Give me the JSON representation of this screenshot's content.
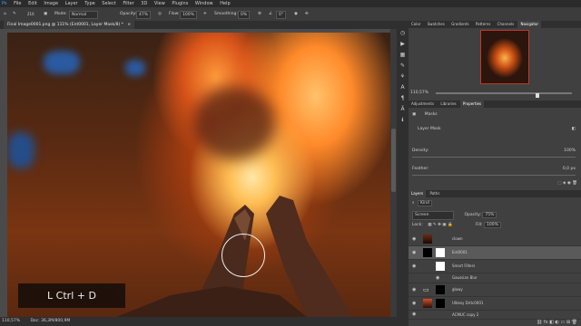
{
  "menu": [
    "Ps",
    "File",
    "Edit",
    "Image",
    "Layer",
    "Type",
    "Select",
    "Filter",
    "3D",
    "View",
    "Plugins",
    "Window",
    "Help"
  ],
  "options": {
    "brush_size": "216",
    "mode_label": "Mode:",
    "mode_value": "Normal",
    "opacity_label": "Opacity:",
    "opacity_value": "47%",
    "flow_label": "Flow:",
    "flow_value": "100%",
    "smoothing_label": "Smoothing:",
    "smoothing_value": "0%",
    "angle_value": "0°"
  },
  "document": {
    "tab_title": "Final Image0001.png @ 111% (Ent0001, Layer Mask/8) *",
    "zoom": "110,57%",
    "doc_info": "Doc: 36,3M/800,9M"
  },
  "overlay": {
    "shortcut_text": "L Ctrl + D"
  },
  "panels": {
    "top_tabs": [
      "Color",
      "Swatches",
      "Gradients",
      "Patterns",
      "Channels",
      "Navigator"
    ],
    "top_active": "Navigator",
    "nav_zoom": "110,57%",
    "mid_tabs": [
      "Adjustments",
      "Libraries",
      "Properties"
    ],
    "mid_active": "Properties",
    "masks_label": "Masks",
    "layer_mask_label": "Layer Mask",
    "density_label": "Density:",
    "density_value": "100%",
    "feather_label": "Feather:",
    "feather_value": "0,0 px",
    "layer_tabs": [
      "Layers",
      "Paths"
    ],
    "layer_active": "Layers",
    "kind_value": "Kind",
    "blend_mode": "Screen",
    "opacity_label": "Opacity:",
    "opacity_value": "75%",
    "lock_label": "Lock:",
    "fill_label": "Fill:",
    "fill_value": "100%",
    "layers": [
      {
        "name": "clown",
        "fx": ""
      },
      {
        "name": "Ent0001",
        "fx": ""
      },
      {
        "name": "Smart Filters",
        "fx": ""
      },
      {
        "name": "Gaussian Blur",
        "fx": ""
      },
      {
        "name": "glowy",
        "fx": ""
      },
      {
        "name": "Ulkkey Dirtc0001",
        "fx": ""
      },
      {
        "name": "ACMUC copy 2",
        "fx": ""
      }
    ]
  }
}
